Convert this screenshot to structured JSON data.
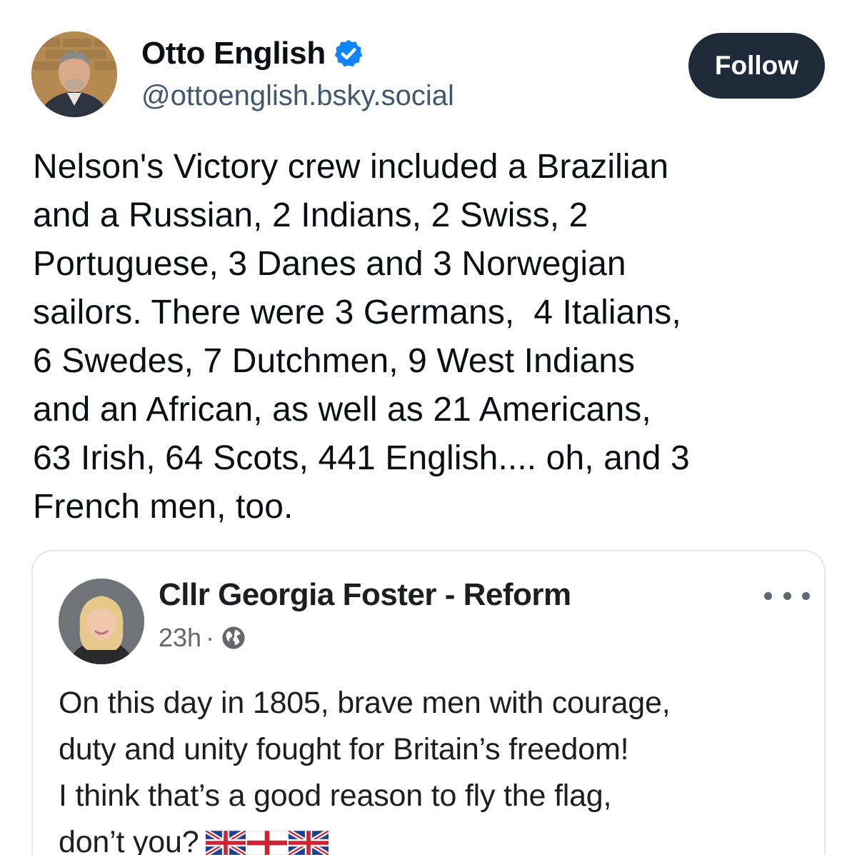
{
  "author": {
    "display_name": "Otto English",
    "handle": "@ottoenglish.bsky.social",
    "verified": true,
    "follow_label": "Follow"
  },
  "post": {
    "text": "Nelson's Victory crew included a Brazilian\nand a Russian, 2 Indians, 2 Swiss, 2\nPortuguese, 3 Danes and 3 Norwegian\nsailors. There were 3 Germans,  4 Italians,\n6 Swedes, 7 Dutchmen, 9 West Indians\nand an African, as well as 21 Americans,\n63 Irish, 64 Scots, 441 English.... oh, and 3\nFrench men, too."
  },
  "embedded_post": {
    "author_name": "Cllr Georgia Foster - Reform",
    "time": "23h",
    "separator": "·",
    "visibility_icon": "globe-icon",
    "more_icon": "more-options-icon",
    "text_lines": [
      "On this day in 1805, brave men with courage,",
      "duty and unity fought for Britain’s freedom!",
      "I think that’s a good reason to fly the flag,",
      "don’t you?"
    ],
    "emoji": [
      "union-jack-flag",
      "england-flag",
      "union-jack-flag"
    ]
  },
  "colors": {
    "follow_button_bg": "#1f2b3a",
    "verified_badge": "#1083fe",
    "handle_text": "#42576c",
    "embed_meta_text": "#65676b"
  }
}
